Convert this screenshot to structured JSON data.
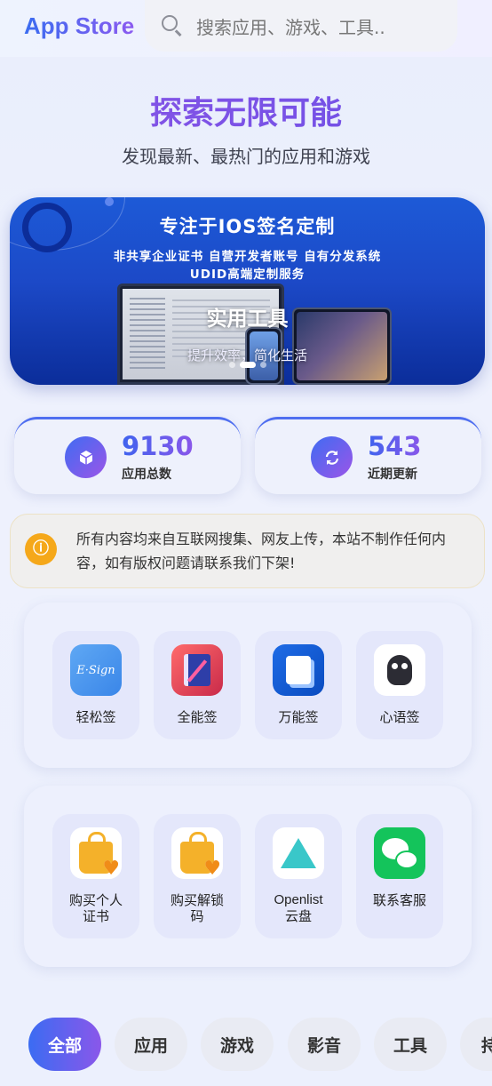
{
  "header": {
    "logo": "App Store",
    "search_placeholder": "搜索应用、游戏、工具.."
  },
  "hero": {
    "title": "探索无限可能",
    "subtitle": "发现最新、最热门的应用和游戏"
  },
  "banner": {
    "line1": "专注于IOS签名定制",
    "line2": "非共享企业证书 自营开发者账号 自有分发系统",
    "line3": "UDID高端定制服务",
    "title": "实用工具",
    "subtitle": "提升效率，简化生活",
    "slide_count": 3,
    "active_slide": 1
  },
  "stats": [
    {
      "value": "9130",
      "label": "应用总数",
      "icon": "cube-icon"
    },
    {
      "value": "543",
      "label": "近期更新",
      "icon": "refresh-icon"
    }
  ],
  "notice": {
    "icon": "info-icon",
    "text": "所有内容均来自互联网搜集、网友上传，本站不制作任何内容，如有版权问题请联系我们下架!"
  },
  "apps_row1": [
    {
      "name": "轻松签",
      "icon_text": "E·Sign"
    },
    {
      "name": "全能签"
    },
    {
      "name": "万能签"
    },
    {
      "name": "心语签"
    }
  ],
  "apps_row2": [
    {
      "name_l1": "购买个人",
      "name_l2": "证书"
    },
    {
      "name_l1": "购买解锁",
      "name_l2": "码"
    },
    {
      "name_l1": "Openlist",
      "name_l2": "云盘"
    },
    {
      "name_l1": "联系客服",
      "name_l2": ""
    }
  ],
  "categories": [
    "全部",
    "应用",
    "游戏",
    "影音",
    "工具",
    "持"
  ],
  "colors": {
    "accent_blue": "#3b6cf2",
    "accent_purple": "#8a57ea",
    "notice_icon": "#f5a81a"
  }
}
